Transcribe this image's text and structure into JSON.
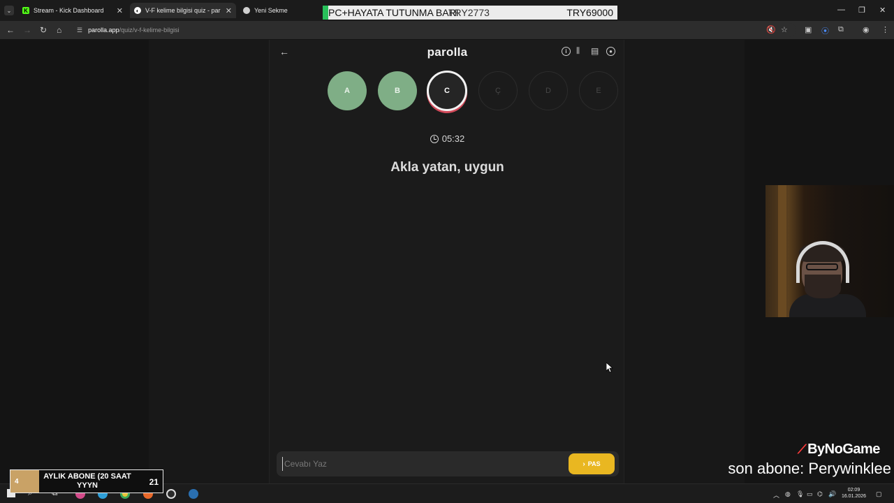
{
  "browser": {
    "tabs": [
      {
        "title": "Stream - Kick Dashboard",
        "icon": "kick-icon"
      },
      {
        "title": "V-F kelime bilgisi quiz - par",
        "icon": "parolla-icon",
        "active": true
      },
      {
        "title": "Yeni Sekme",
        "icon": "chrome-icon"
      }
    ],
    "url_host": "parolla.app",
    "url_path": "/quiz/v-f-kelime-bilgisi"
  },
  "ticker": {
    "text": "PC+HAYATA TUTUNMA BARI",
    "id": "TRY2773",
    "price": "TRY69000"
  },
  "app": {
    "brand": "parolla",
    "letters": [
      {
        "label": "A",
        "state": "done"
      },
      {
        "label": "B",
        "state": "done"
      },
      {
        "label": "C",
        "state": "current"
      },
      {
        "label": "Ç",
        "state": "future"
      },
      {
        "label": "D",
        "state": "future"
      },
      {
        "label": "E",
        "state": "future"
      }
    ],
    "timer": "05:32",
    "question": "Akla yatan, uygun",
    "answer_placeholder": "Cevabı Yaz",
    "pas_label": "PAS"
  },
  "overlay": {
    "sponsor": "ByNoGame",
    "last_sub": "son abone: Perywinklee",
    "goal": {
      "current": "4",
      "title": "AYLIK ABONE (20 SAAT YYYN",
      "target": "21",
      "progress": 0.19
    }
  },
  "taskbar": {
    "time": "02:09",
    "date": "16.01.2026"
  },
  "colors": {
    "done": "#7fae86",
    "current_ring": "#d14a5a",
    "pas": "#e9b721",
    "ticker_accent": "#28c05a"
  }
}
